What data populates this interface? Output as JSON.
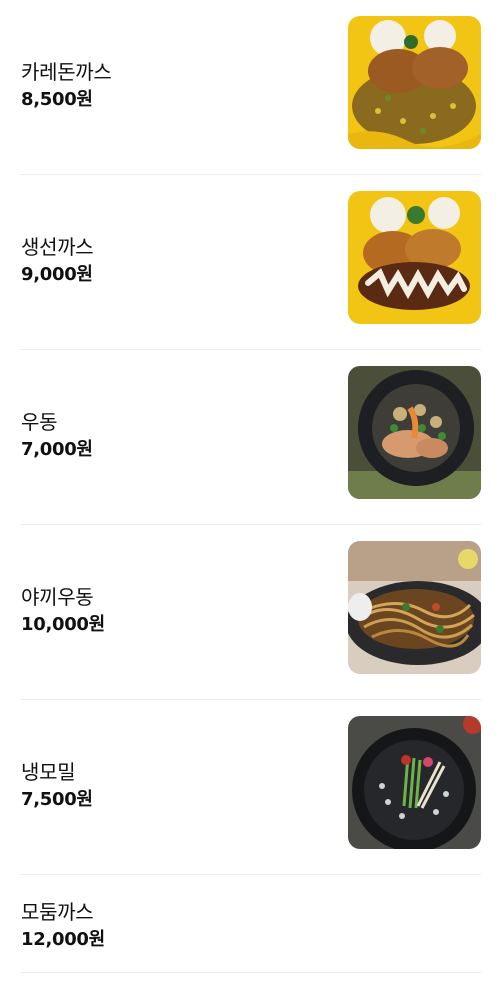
{
  "menu": {
    "items": [
      {
        "name": "카레돈까스",
        "price": "8,500원",
        "image": "katsu-curry-photo"
      },
      {
        "name": "생선까스",
        "price": "9,000원",
        "image": "fish-cutlet-photo"
      },
      {
        "name": "우동",
        "price": "7,000원",
        "image": "udon-photo"
      },
      {
        "name": "야끼우동",
        "price": "10,000원",
        "image": "yaki-udon-photo"
      },
      {
        "name": "냉모밀",
        "price": "7,500원",
        "image": "cold-soba-photo"
      },
      {
        "name": "모둠까스",
        "price": "12,000원",
        "image": null
      }
    ]
  },
  "colors": {
    "text": "#111111",
    "divider": "#ececec",
    "plate_yellow": "#f2c514"
  }
}
